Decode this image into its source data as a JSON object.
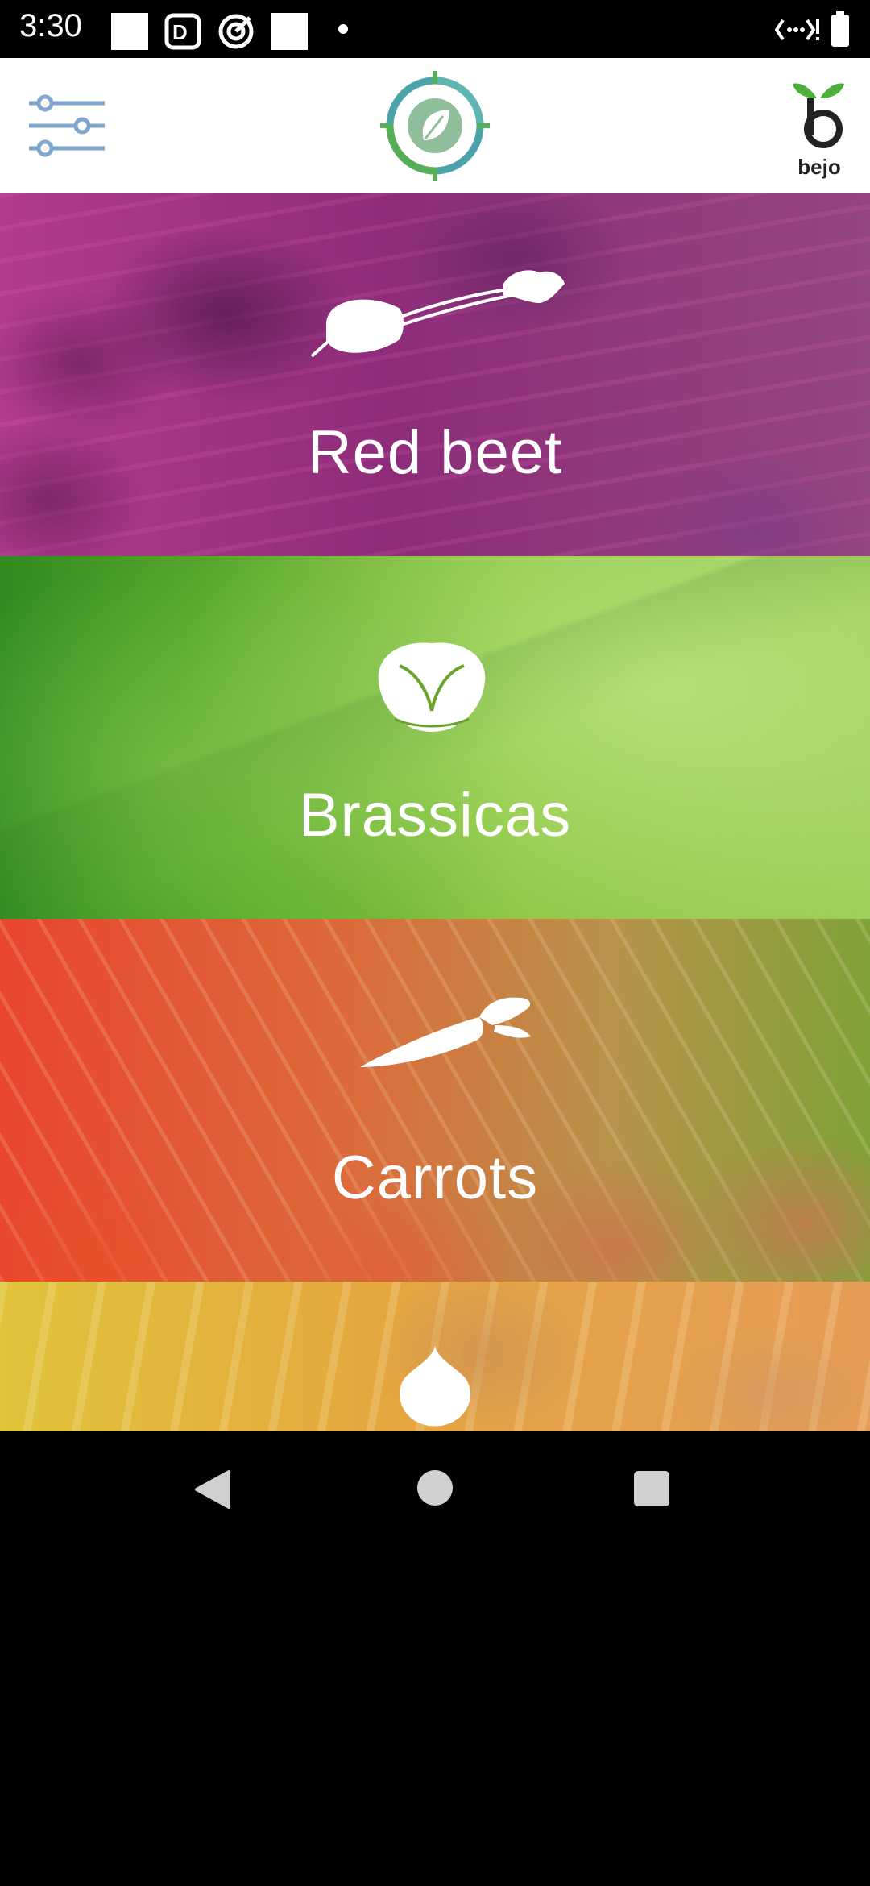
{
  "status_bar": {
    "time": "3:30"
  },
  "header": {
    "menu_icon": "sliders-icon",
    "logo_icon": "leaf-target-logo",
    "brand_logo": "bejo-logo",
    "brand_text": "bejo"
  },
  "crops": [
    {
      "label": "Red beet",
      "icon": "beet-icon",
      "color": "#9b2a7e"
    },
    {
      "label": "Brassicas",
      "icon": "cabbage-icon",
      "color": "#6aa32c"
    },
    {
      "label": "Carrots",
      "icon": "carrot-icon",
      "color": "#ea5a2c"
    },
    {
      "label": "",
      "icon": "onion-icon",
      "color": "#e8a43a"
    }
  ],
  "navigation": {
    "back": "back-icon",
    "home": "home-icon",
    "recents": "recents-icon"
  },
  "colors": {
    "header_bg": "#ffffff",
    "menu_icon": "#7fa6cc",
    "logo_ring": "#4aa3a8",
    "logo_green": "#55ad55"
  }
}
